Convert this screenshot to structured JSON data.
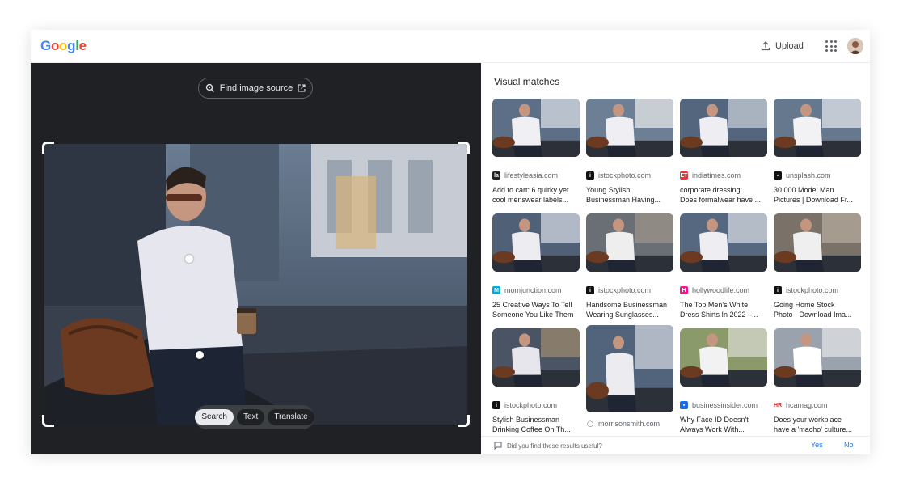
{
  "header": {
    "logo": [
      "G",
      "o",
      "o",
      "g",
      "l",
      "e"
    ],
    "logo_colors": [
      "#4285f4",
      "#ea4335",
      "#fbbc05",
      "#4285f4",
      "#34a853",
      "#ea4335"
    ],
    "upload_label": "Upload"
  },
  "left": {
    "find_source_label": "Find image source",
    "modes": [
      "Search",
      "Text",
      "Translate"
    ],
    "active_mode": "Search"
  },
  "right": {
    "title": "Visual matches",
    "results": [
      {
        "source": "lifestyleasia.com",
        "favicon": "lifestyleasia-icon",
        "title": [
          "Add to cart: 6 quirky yet",
          "cool menswear labels..."
        ]
      },
      {
        "source": "istockphoto.com",
        "favicon": "istock-icon",
        "title": [
          "Young Stylish",
          "Businessman Having..."
        ]
      },
      {
        "source": "indiatimes.com",
        "favicon": "indiatimes-icon",
        "title": [
          "corporate dressing:",
          "Does formalwear have ..."
        ]
      },
      {
        "source": "unsplash.com",
        "favicon": "unsplash-icon",
        "title": [
          "30,000 Model Man",
          "Pictures | Download Fr..."
        ]
      },
      {
        "source": "momjunction.com",
        "favicon": "momjunction-icon",
        "title": [
          "25 Creative Ways To Tell",
          "Someone You Like Them"
        ]
      },
      {
        "source": "istockphoto.com",
        "favicon": "istock-icon",
        "title": [
          "Handsome Businessman",
          "Wearing Sunglasses..."
        ]
      },
      {
        "source": "hollywoodlife.com",
        "favicon": "hollywoodlife-icon",
        "title": [
          "The Top Men's White",
          "Dress Shirts In 2022 –..."
        ]
      },
      {
        "source": "istockphoto.com",
        "favicon": "istock-icon",
        "title": [
          "Going Home Stock",
          "Photo - Download Ima..."
        ]
      },
      {
        "source": "istockphoto.com",
        "favicon": "istock-icon",
        "title": [
          "Stylish Businessman",
          "Drinking Coffee On Th..."
        ]
      },
      {
        "source": "morrisonsmith.com",
        "favicon": "morrisonsmith-icon",
        "title": []
      },
      {
        "source": "businessinsider.com",
        "favicon": "businessinsider-icon",
        "title": [
          "Why Face ID Doesn't",
          "Always Work With..."
        ]
      },
      {
        "source": "hcamag.com",
        "favicon": "hcamag-icon",
        "title": [
          "Does your workplace",
          "have a 'macho' culture..."
        ]
      }
    ],
    "feedback": {
      "question": "Did you find these results useful?",
      "yes": "Yes",
      "no": "No"
    }
  }
}
